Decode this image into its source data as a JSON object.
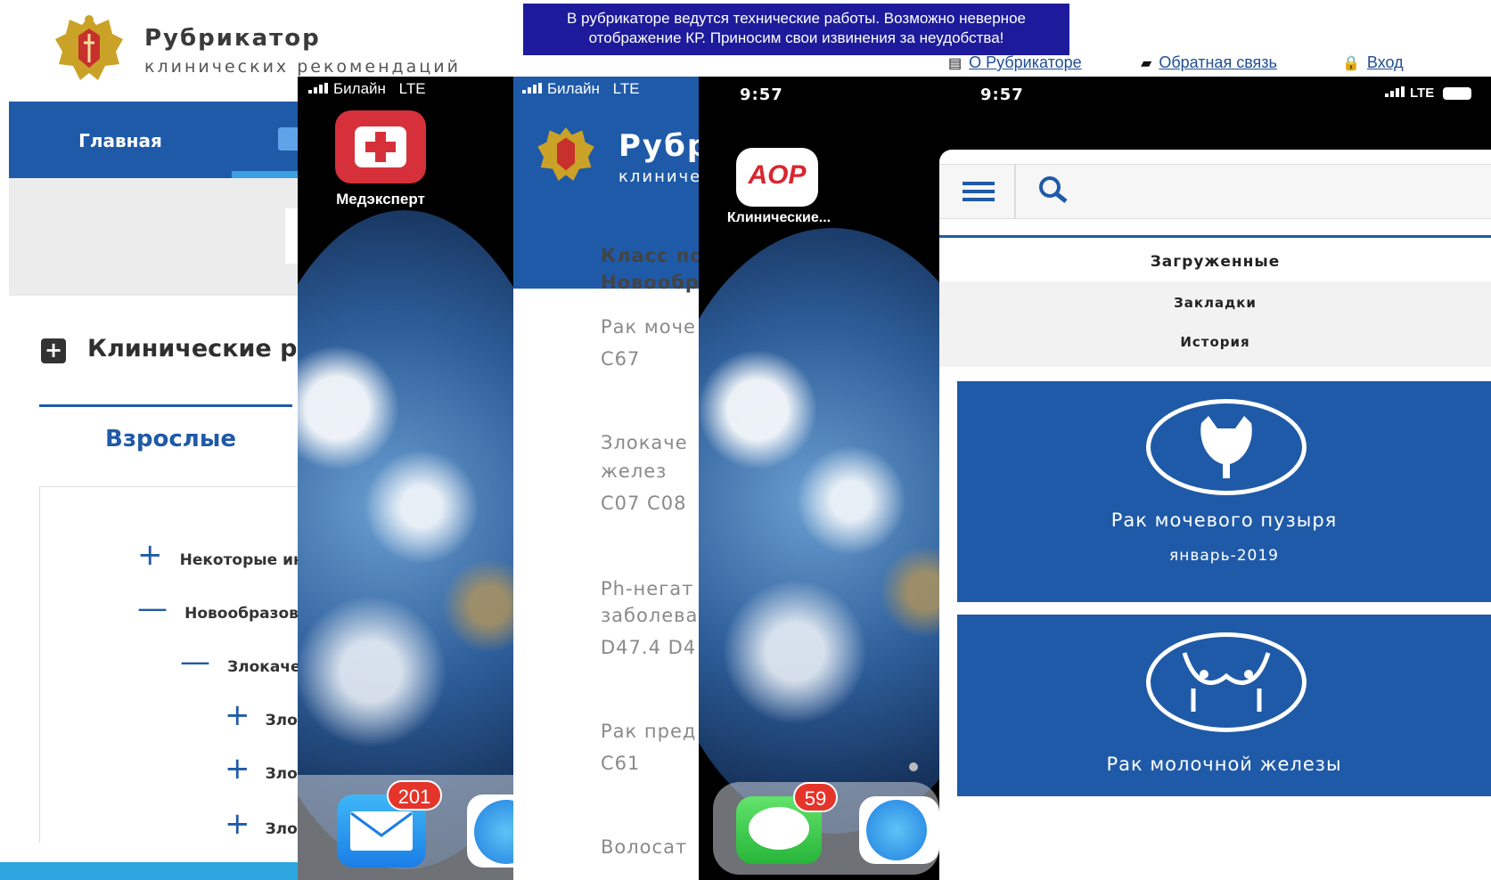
{
  "site": {
    "title": "Рубрикатор",
    "subtitle": "клинических рекомендаций",
    "notice_line1": "В рубрикаторе ведутся технические работы. Возможно неверное",
    "notice_line2": "отображение КР. Приносим свои извинения за неудобства!",
    "links": {
      "about": "О Рубрикаторе",
      "feedback": "Обратная связь",
      "login": "Вход"
    },
    "nav_home": "Главная",
    "section_title": "Клинические рек",
    "adult_tab": "Взрослые",
    "tree": [
      {
        "mark": "+",
        "label": "Некоторые ин"
      },
      {
        "mark": "—",
        "label": "Новообразова"
      },
      {
        "mark": "—",
        "label": "Злокаче"
      },
      {
        "mark": "+",
        "label": "Зло"
      },
      {
        "mark": "+",
        "label": "Зло"
      },
      {
        "mark": "+",
        "label": "Зло"
      }
    ]
  },
  "phone1": {
    "carrier": "Билайн",
    "network": "LTE",
    "app_label": "Медэксперт",
    "mail_badge": "201"
  },
  "phone2": {
    "carrier": "Билайн",
    "network": "LTE",
    "header_title": "Рубр",
    "header_subtitle": "клиниче",
    "class_line1": "Класс по",
    "class_line2": "Новообр",
    "items": [
      {
        "name": "Рак моче",
        "code": "C67"
      },
      {
        "name1": "Злокаче",
        "name2": "желез",
        "code": "C07 C08"
      },
      {
        "name1": "Ph-негат",
        "name2": "заболева",
        "code": "D47.4 D4"
      },
      {
        "name": "Рак пред",
        "code": "C61"
      },
      {
        "name": "Волосат"
      }
    ]
  },
  "phone3": {
    "time": "9:57",
    "app_icon_text": "AOP",
    "app_label": "Клинические...",
    "messages_badge": "59"
  },
  "phone4": {
    "time": "9:57",
    "network": "LTE",
    "tab_downloaded": "Загруженные",
    "tab_bookmarks": "Закладки",
    "tab_history": "История",
    "cards": [
      {
        "title": "Рак мочевого пузыря",
        "date": "январь-2019"
      },
      {
        "title": "Рак молочной железы"
      }
    ]
  }
}
